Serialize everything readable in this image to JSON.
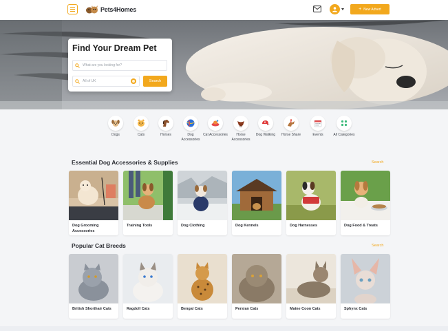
{
  "header": {
    "logo_text": "Pets4Homes",
    "new_advert_label": "New Advert"
  },
  "hero": {
    "title": "Find Your Dream Pet",
    "search_placeholder": "What are you looking for?",
    "location_placeholder": "All of UK",
    "search_button": "Search"
  },
  "categories": [
    {
      "label": "Dogs",
      "icon": "dog-icon"
    },
    {
      "label": "Cats",
      "icon": "cat-icon"
    },
    {
      "label": "Horses",
      "icon": "horse-icon"
    },
    {
      "label": "Dog Accessories",
      "icon": "ball-icon"
    },
    {
      "label": "Cat Accessories",
      "icon": "cat-toy-icon"
    },
    {
      "label": "Horse Accessories",
      "icon": "saddle-icon"
    },
    {
      "label": "Dog Walking",
      "icon": "cap-icon"
    },
    {
      "label": "Horse Share",
      "icon": "rider-icon"
    },
    {
      "label": "Events",
      "icon": "calendar-icon"
    },
    {
      "label": "All Categories",
      "icon": "grid-icon"
    }
  ],
  "dog_section": {
    "title": "Essential Dog Accessories & Supplies",
    "link": "Search",
    "cards": [
      {
        "label": "Dog Grooming Accessories",
        "image": "grooming-photo"
      },
      {
        "label": "Training Tools",
        "image": "training-photo"
      },
      {
        "label": "Dog Clothing",
        "image": "clothing-photo"
      },
      {
        "label": "Dog Kennels",
        "image": "kennel-photo"
      },
      {
        "label": "Dog Harnesses",
        "image": "harness-photo"
      },
      {
        "label": "Dog Food & Treats",
        "image": "food-photo"
      }
    ]
  },
  "cat_section": {
    "title": "Popular Cat Breeds",
    "link": "Search",
    "cards": [
      {
        "label": "British Shorthair Cats",
        "image": "british-shorthair-photo"
      },
      {
        "label": "Ragdoll Cats",
        "image": "ragdoll-photo"
      },
      {
        "label": "Bengal Cats",
        "image": "bengal-photo"
      },
      {
        "label": "Persian Cats",
        "image": "persian-photo"
      },
      {
        "label": "Maine Coon Cats",
        "image": "maine-coon-photo"
      },
      {
        "label": "Sphynx Cats",
        "image": "sphynx-photo"
      }
    ]
  },
  "colors": {
    "accent": "#f2a81d",
    "page_bg": "#f4f5f7"
  }
}
